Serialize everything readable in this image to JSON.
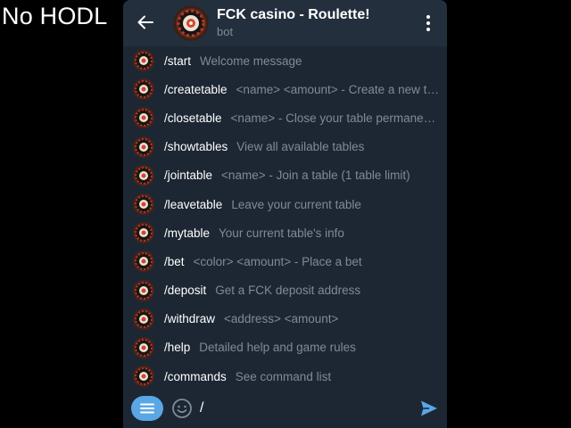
{
  "overlay": {
    "caption": "No HODL"
  },
  "header": {
    "title": "FCK casino - Roulette!",
    "subtitle": "bot",
    "back_icon": "arrow-left-icon",
    "menu_icon": "more-vertical-icon"
  },
  "commands": [
    {
      "command": "/start",
      "description": "Welcome message"
    },
    {
      "command": "/createtable",
      "description": "<name> <amount> - Create a new ta..."
    },
    {
      "command": "/closetable",
      "description": "<name> - Close your table permanently"
    },
    {
      "command": "/showtables",
      "description": "View all available tables"
    },
    {
      "command": "/jointable",
      "description": "<name> - Join a table (1 table limit)"
    },
    {
      "command": "/leavetable",
      "description": "Leave your current table"
    },
    {
      "command": "/mytable",
      "description": "Your current table's info"
    },
    {
      "command": "/bet",
      "description": "<color> <amount> - Place a bet"
    },
    {
      "command": "/deposit",
      "description": "Get a FCK deposit address"
    },
    {
      "command": "/withdraw",
      "description": "<address> <amount>"
    },
    {
      "command": "/help",
      "description": "Detailed help and game rules"
    },
    {
      "command": "/commands",
      "description": "See command list"
    }
  ],
  "input": {
    "value": "/",
    "menu_icon": "bot-menu-icon",
    "emoji_icon": "emoji-smile-icon",
    "send_icon": "send-icon"
  },
  "colors": {
    "background": "#1d2733",
    "header": "#242f3d",
    "accent": "#5aa7e6",
    "description_text": "#7f8b97"
  }
}
